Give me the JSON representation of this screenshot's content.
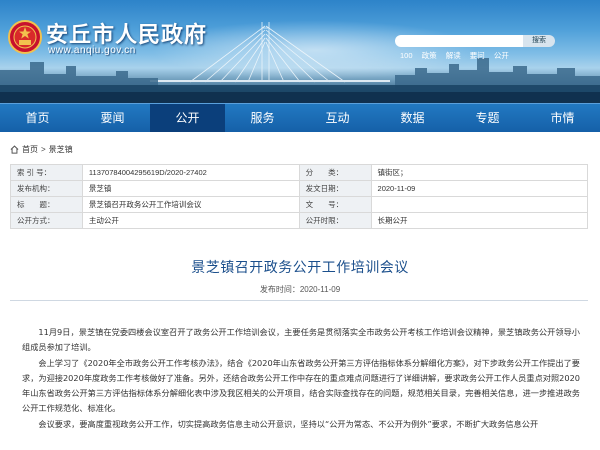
{
  "header": {
    "site_title": "安丘市人民政府",
    "site_url": "www.anqiu.gov.cn",
    "search_placeholder": "",
    "search_button": "搜索",
    "hot_links": [
      "100",
      "政策",
      "解读",
      "要问",
      "公开"
    ]
  },
  "nav": {
    "items": [
      "首页",
      "要闻",
      "公开",
      "服务",
      "互动",
      "数据",
      "专题",
      "市情"
    ],
    "active_index": 2
  },
  "breadcrumb": {
    "items": [
      "首页",
      "景芝镇"
    ],
    "separator": ">"
  },
  "meta": {
    "rows": [
      {
        "l1": "索 引 号：",
        "v1": "11370784004295619D/2020-27402",
        "l2": "分　　类：",
        "v2": "镇街区；"
      },
      {
        "l1": "发布机构：",
        "v1": "景芝镇",
        "l2": "发文日期：",
        "v2": "2020-11-09"
      },
      {
        "l1": "标　　题：",
        "v1": "景芝镇召开政务公开工作培训会议",
        "l2": "文　　号：",
        "v2": ""
      },
      {
        "l1": "公开方式：",
        "v1": "主动公开",
        "l2": "公开时限：",
        "v2": "长期公开"
      }
    ]
  },
  "article": {
    "title": "景芝镇召开政务公开工作培训会议",
    "publish_label": "发布时间：2020-11-09",
    "paragraphs": [
      "11月9日，景芝镇在党委四楼会议室召开了政务公开工作培训会议，主要任务是贯彻落实全市政务公开考核工作培训会议精神，景芝镇政务公开领导小组成员参加了培训。",
      "会上学习了《2020年全市政务公开工作考核办法》，结合《2020年山东省政务公开第三方评估指标体系分解细化方案》，对下步政务公开工作提出了要求，为迎接2020年度政务工作考核做好了准备。另外，还结合政务公开工作中存在的重点难点问题进行了详细讲解，要求政务公开工作人员重点对照2020年山东省政务公开第三方评估指标体系分解细化表中涉及我区相关的公开项目，结合实际查找存在的问题，规范相关目录，完善相关信息，进一步推进政务公开工作规范化、标准化。",
      "会议要求，要高度重视政务公开工作，切实提高政务信息主动公开意识，坚持以“公开为常态、不公开为例外”要求，不断扩大政务信息公开"
    ]
  },
  "colors": {
    "nav_bg": "#1560a8",
    "nav_active": "#0b3f7b",
    "title_color": "#1b4f8c"
  }
}
